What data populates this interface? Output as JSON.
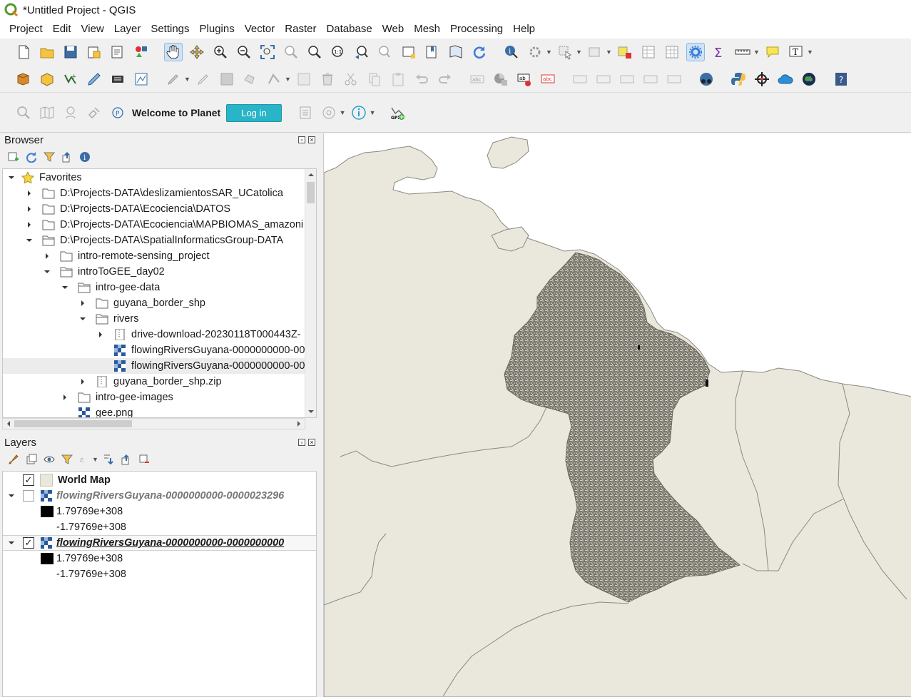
{
  "window": {
    "title": "*Untitled Project - QGIS"
  },
  "menu": [
    "Project",
    "Edit",
    "View",
    "Layer",
    "Settings",
    "Plugins",
    "Vector",
    "Raster",
    "Database",
    "Web",
    "Mesh",
    "Processing",
    "Help"
  ],
  "planet": {
    "welcome": "Welcome to Planet",
    "login": "Log in"
  },
  "browser": {
    "title": "Browser",
    "rows": [
      {
        "label": "Favorites"
      },
      {
        "label": "D:\\Projects-DATA\\deslizamientosSAR_UCatolica"
      },
      {
        "label": "D:\\Projects-DATA\\Ecociencia\\DATOS"
      },
      {
        "label": "D:\\Projects-DATA\\Ecociencia\\MAPBIOMAS_amazoni"
      },
      {
        "label": "D:\\Projects-DATA\\SpatialInformaticsGroup-DATA"
      },
      {
        "label": "intro-remote-sensing_project"
      },
      {
        "label": "introToGEE_day02"
      },
      {
        "label": "intro-gee-data"
      },
      {
        "label": "guyana_border_shp"
      },
      {
        "label": "rivers"
      },
      {
        "label": "drive-download-20230118T000443Z-"
      },
      {
        "label": "flowingRiversGuyana-0000000000-00"
      },
      {
        "label": "flowingRiversGuyana-0000000000-00"
      },
      {
        "label": "guyana_border_shp.zip"
      },
      {
        "label": "intro-gee-images"
      },
      {
        "label": "gee.png"
      }
    ]
  },
  "layers": {
    "title": "Layers",
    "items": [
      {
        "name": "World Map"
      },
      {
        "name": "flowingRiversGuyana-0000000000-0000023296",
        "legend": [
          "1.79769e+308",
          "-1.79769e+308"
        ]
      },
      {
        "name": "flowingRiversGuyana-0000000000-0000000000",
        "legend": [
          "1.79769e+308",
          "-1.79769e+308"
        ]
      }
    ]
  },
  "colors": {
    "land": "#eae7dc",
    "border": "#8a8a80",
    "raster": "#7a776c",
    "accent": "#29b4c8"
  }
}
